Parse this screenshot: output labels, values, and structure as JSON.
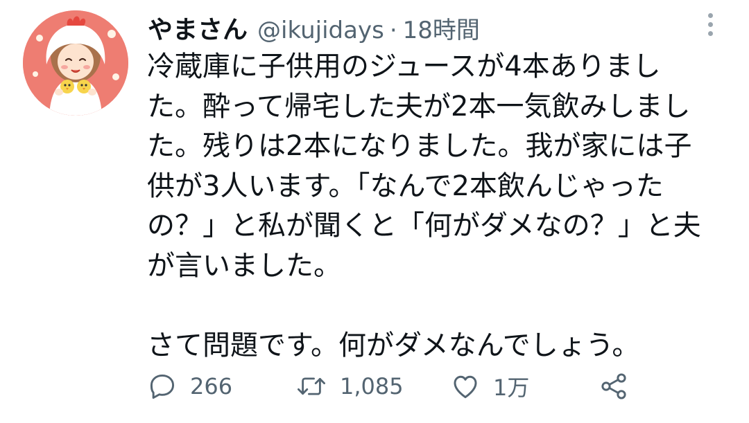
{
  "tweet": {
    "display_name": "やまさん",
    "handle": "@ikujidays",
    "separator": "·",
    "time": "18時間",
    "lines": [
      "冷蔵庫に子供用のジュースが4本ありまし",
      "た。酔って帰宅した夫が2本一気飲みしまし",
      "た。残りは2本になりました。我が家には子",
      "供が3人います。「なんで2本飲んじゃった",
      "の？」と私が聞くと「何がダメなの？」と夫",
      "が言いました。",
      "",
      "さて問題です。何がダメなんでしょう。"
    ],
    "actions": {
      "reply_count": "266",
      "retweet_count": "1,085",
      "like_count": "1万"
    }
  },
  "colors": {
    "avatar_bg": "#ee7d72",
    "text": "#0f1419",
    "secondary": "#536471"
  },
  "icons": [
    "more-vertical-icon",
    "reply-icon",
    "retweet-icon",
    "heart-icon",
    "share-icon"
  ]
}
